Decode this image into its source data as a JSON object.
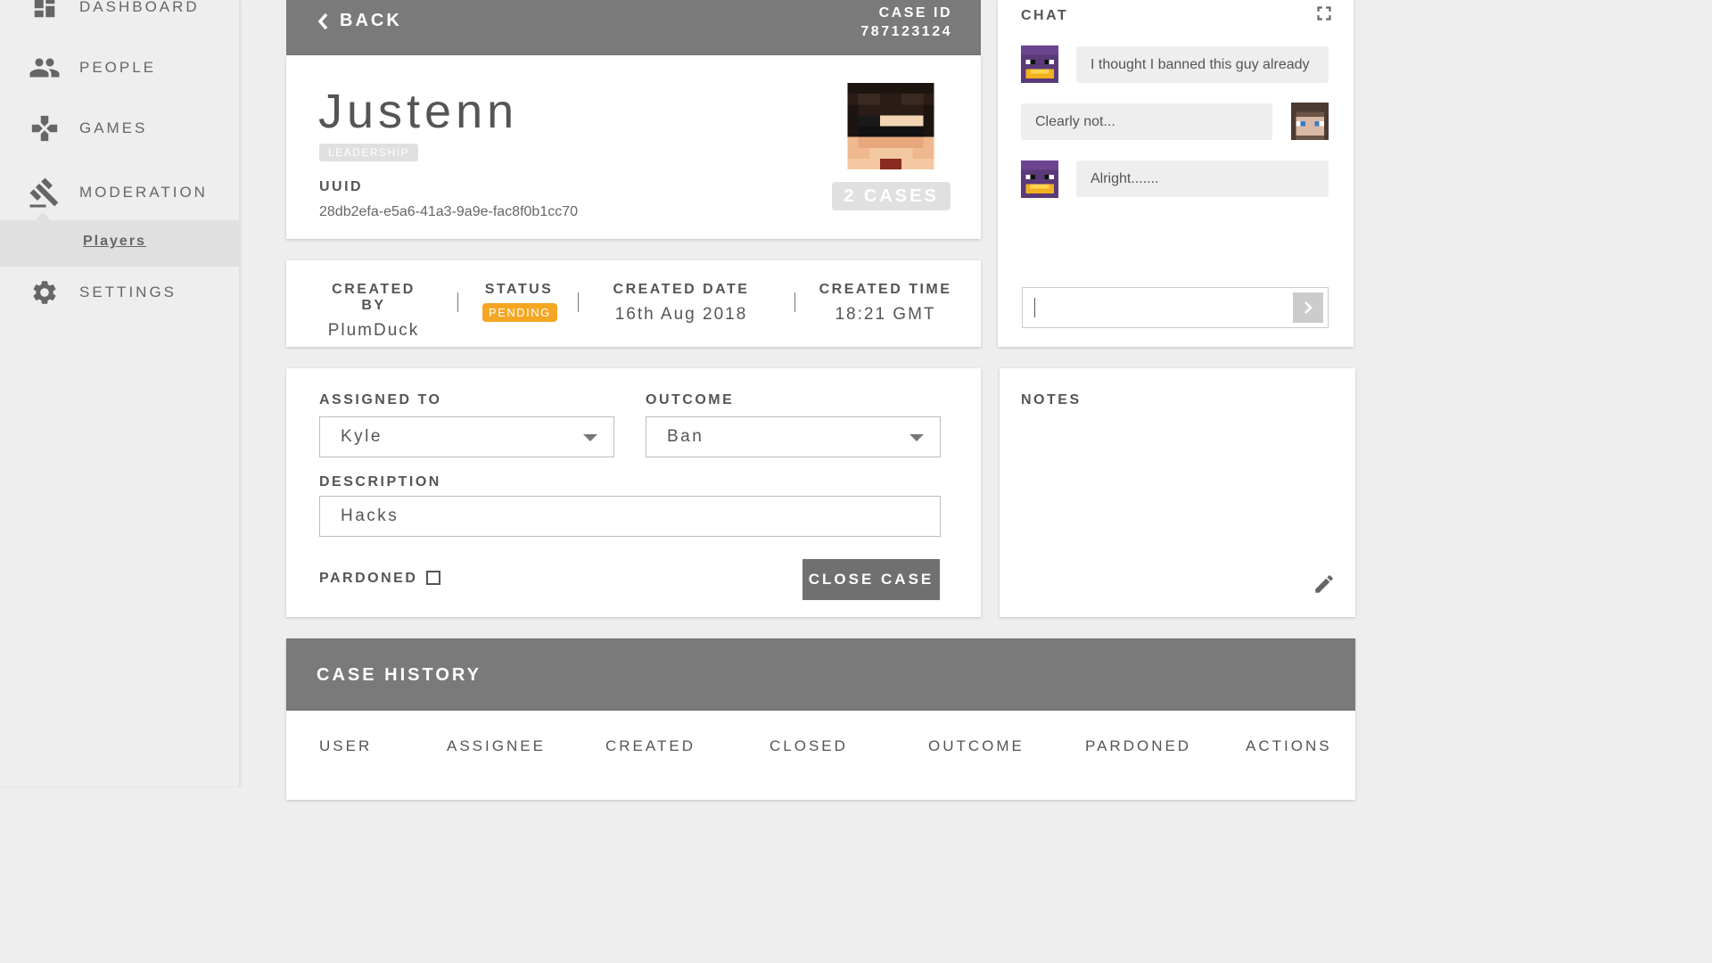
{
  "sidebar": {
    "items": [
      {
        "label": "DASHBOARD",
        "icon": "dashboard-icon"
      },
      {
        "label": "PEOPLE",
        "icon": "people-icon"
      },
      {
        "label": "GAMES",
        "icon": "gamepad-icon"
      },
      {
        "label": "MODERATION",
        "icon": "gavel-icon"
      },
      {
        "label": "SETTINGS",
        "icon": "gear-icon"
      }
    ],
    "sub_item": "Players"
  },
  "profile": {
    "back_label": "BACK",
    "case_id_label": "CASE ID",
    "case_id": "787123124",
    "name": "Justenn",
    "role": "LEADERSHIP",
    "uuid_label": "UUID",
    "uuid": "28db2efa-e5a6-41a3-9a9e-fac8f0b1cc70",
    "cases": "2 CASES"
  },
  "info": {
    "created_by_label": "CREATED BY",
    "created_by": "PlumDuck",
    "status_label": "STATUS",
    "status": "PENDING",
    "created_date_label": "CREATED DATE",
    "created_date": "16th Aug 2018",
    "created_time_label": "CREATED TIME",
    "created_time": "18:21 GMT"
  },
  "chat": {
    "title": "CHAT",
    "messages": [
      {
        "text": "I thought I banned this guy already",
        "side": "left"
      },
      {
        "text": "Clearly not...",
        "side": "right"
      },
      {
        "text": "Alright.......",
        "side": "left"
      }
    ],
    "input_value": ""
  },
  "assign": {
    "assigned_label": "ASSIGNED TO",
    "assigned_value": "Kyle",
    "outcome_label": "OUTCOME",
    "outcome_value": "Ban",
    "description_label": "DESCRIPTION",
    "description_value": "Hacks",
    "pardoned_label": "PARDONED",
    "close_label": "CLOSE CASE"
  },
  "notes": {
    "title": "NOTES"
  },
  "history": {
    "title": "CASE HISTORY",
    "columns": [
      "USER",
      "ASSIGNEE",
      "CREATED",
      "CLOSED",
      "OUTCOME",
      "PARDONED",
      "ACTIONS"
    ]
  },
  "colors": {
    "status_pending": "#f5a623",
    "header_gray": "#7a7a7a"
  }
}
